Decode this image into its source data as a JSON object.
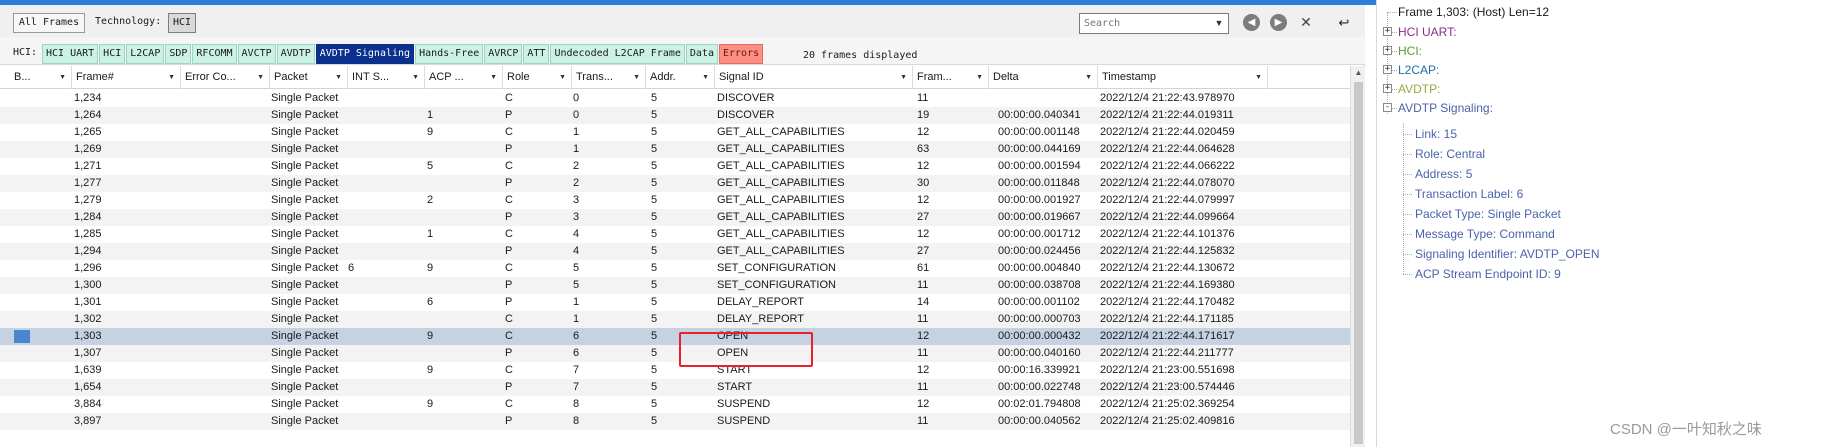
{
  "toolbar": {
    "all_frames": "All Frames",
    "technology_label": "Technology:",
    "technology_value": "HCI",
    "search_placeholder": "Search",
    "prev_icon": "arrow-left-circle-icon",
    "next_icon": "arrow-right-circle-icon",
    "close_icon": "close-icon",
    "export_icon": "export-icon"
  },
  "filterbar": {
    "label": "HCI:",
    "filters": [
      {
        "label": "HCI UART",
        "state": "normal"
      },
      {
        "label": "HCI",
        "state": "normal"
      },
      {
        "label": "L2CAP",
        "state": "normal"
      },
      {
        "label": "SDP",
        "state": "normal"
      },
      {
        "label": "RFCOMM",
        "state": "normal"
      },
      {
        "label": "AVCTP",
        "state": "normal"
      },
      {
        "label": "AVDTP",
        "state": "normal"
      },
      {
        "label": "AVDTP Signaling",
        "state": "active"
      },
      {
        "label": "Hands-Free",
        "state": "normal"
      },
      {
        "label": "AVRCP",
        "state": "normal"
      },
      {
        "label": "ATT",
        "state": "normal"
      },
      {
        "label": "Undecoded L2CAP Frame",
        "state": "normal"
      },
      {
        "label": "Data",
        "state": "normal"
      },
      {
        "label": "Errors",
        "state": "error"
      }
    ],
    "frames_displayed": "20 frames displayed"
  },
  "table": {
    "columns": [
      "B...",
      "Frame#",
      "Error Co...",
      "Packet",
      "INT S...",
      "ACP ...",
      "Role",
      "Trans...",
      "Addr.",
      "Signal ID",
      "Fram...",
      "Delta",
      "Timestamp"
    ],
    "rows": [
      {
        "frame": "1,234",
        "packet": "Single Packet",
        "int": "",
        "acp": "",
        "role": "C",
        "trans": "0",
        "addr": "5",
        "signal": "DISCOVER",
        "fram": "11",
        "delta": "",
        "ts": "2022/12/4 21:22:43.978970"
      },
      {
        "frame": "1,264",
        "packet": "Single Packet",
        "int": "",
        "acp": "1",
        "role": "P",
        "trans": "0",
        "addr": "5",
        "signal": "DISCOVER",
        "fram": "19",
        "delta": "00:00:00.040341",
        "ts": "2022/12/4 21:22:44.019311"
      },
      {
        "frame": "1,265",
        "packet": "Single Packet",
        "int": "",
        "acp": "9",
        "role": "C",
        "trans": "1",
        "addr": "5",
        "signal": "GET_ALL_CAPABILITIES",
        "fram": "12",
        "delta": "00:00:00.001148",
        "ts": "2022/12/4 21:22:44.020459"
      },
      {
        "frame": "1,269",
        "packet": "Single Packet",
        "int": "",
        "acp": "",
        "role": "P",
        "trans": "1",
        "addr": "5",
        "signal": "GET_ALL_CAPABILITIES",
        "fram": "63",
        "delta": "00:00:00.044169",
        "ts": "2022/12/4 21:22:44.064628"
      },
      {
        "frame": "1,271",
        "packet": "Single Packet",
        "int": "",
        "acp": "5",
        "role": "C",
        "trans": "2",
        "addr": "5",
        "signal": "GET_ALL_CAPABILITIES",
        "fram": "12",
        "delta": "00:00:00.001594",
        "ts": "2022/12/4 21:22:44.066222"
      },
      {
        "frame": "1,277",
        "packet": "Single Packet",
        "int": "",
        "acp": "",
        "role": "P",
        "trans": "2",
        "addr": "5",
        "signal": "GET_ALL_CAPABILITIES",
        "fram": "30",
        "delta": "00:00:00.011848",
        "ts": "2022/12/4 21:22:44.078070"
      },
      {
        "frame": "1,279",
        "packet": "Single Packet",
        "int": "",
        "acp": "2",
        "role": "C",
        "trans": "3",
        "addr": "5",
        "signal": "GET_ALL_CAPABILITIES",
        "fram": "12",
        "delta": "00:00:00.001927",
        "ts": "2022/12/4 21:22:44.079997"
      },
      {
        "frame": "1,284",
        "packet": "Single Packet",
        "int": "",
        "acp": "",
        "role": "P",
        "trans": "3",
        "addr": "5",
        "signal": "GET_ALL_CAPABILITIES",
        "fram": "27",
        "delta": "00:00:00.019667",
        "ts": "2022/12/4 21:22:44.099664"
      },
      {
        "frame": "1,285",
        "packet": "Single Packet",
        "int": "",
        "acp": "1",
        "role": "C",
        "trans": "4",
        "addr": "5",
        "signal": "GET_ALL_CAPABILITIES",
        "fram": "12",
        "delta": "00:00:00.001712",
        "ts": "2022/12/4 21:22:44.101376"
      },
      {
        "frame": "1,294",
        "packet": "Single Packet",
        "int": "",
        "acp": "",
        "role": "P",
        "trans": "4",
        "addr": "5",
        "signal": "GET_ALL_CAPABILITIES",
        "fram": "27",
        "delta": "00:00:00.024456",
        "ts": "2022/12/4 21:22:44.125832"
      },
      {
        "frame": "1,296",
        "packet": "Single Packet",
        "int": "6",
        "acp": "9",
        "role": "C",
        "trans": "5",
        "addr": "5",
        "signal": "SET_CONFIGURATION",
        "fram": "61",
        "delta": "00:00:00.004840",
        "ts": "2022/12/4 21:22:44.130672"
      },
      {
        "frame": "1,300",
        "packet": "Single Packet",
        "int": "",
        "acp": "",
        "role": "P",
        "trans": "5",
        "addr": "5",
        "signal": "SET_CONFIGURATION",
        "fram": "11",
        "delta": "00:00:00.038708",
        "ts": "2022/12/4 21:22:44.169380"
      },
      {
        "frame": "1,301",
        "packet": "Single Packet",
        "int": "",
        "acp": "6",
        "role": "P",
        "trans": "1",
        "addr": "5",
        "signal": "DELAY_REPORT",
        "fram": "14",
        "delta": "00:00:00.001102",
        "ts": "2022/12/4 21:22:44.170482"
      },
      {
        "frame": "1,302",
        "packet": "Single Packet",
        "int": "",
        "acp": "",
        "role": "C",
        "trans": "1",
        "addr": "5",
        "signal": "DELAY_REPORT",
        "fram": "11",
        "delta": "00:00:00.000703",
        "ts": "2022/12/4 21:22:44.171185"
      },
      {
        "frame": "1,303",
        "packet": "Single Packet",
        "int": "",
        "acp": "9",
        "role": "C",
        "trans": "6",
        "addr": "5",
        "signal": "OPEN",
        "fram": "12",
        "delta": "00:00:00.000432",
        "ts": "2022/12/4 21:22:44.171617"
      },
      {
        "frame": "1,307",
        "packet": "Single Packet",
        "int": "",
        "acp": "",
        "role": "P",
        "trans": "6",
        "addr": "5",
        "signal": "OPEN",
        "fram": "11",
        "delta": "00:00:00.040160",
        "ts": "2022/12/4 21:22:44.211777"
      },
      {
        "frame": "1,639",
        "packet": "Single Packet",
        "int": "",
        "acp": "9",
        "role": "C",
        "trans": "7",
        "addr": "5",
        "signal": "START",
        "fram": "12",
        "delta": "00:00:16.339921",
        "ts": "2022/12/4 21:23:00.551698"
      },
      {
        "frame": "1,654",
        "packet": "Single Packet",
        "int": "",
        "acp": "",
        "role": "P",
        "trans": "7",
        "addr": "5",
        "signal": "START",
        "fram": "11",
        "delta": "00:00:00.022748",
        "ts": "2022/12/4 21:23:00.574446"
      },
      {
        "frame": "3,884",
        "packet": "Single Packet",
        "int": "",
        "acp": "9",
        "role": "C",
        "trans": "8",
        "addr": "5",
        "signal": "SUSPEND",
        "fram": "12",
        "delta": "00:02:01.794808",
        "ts": "2022/12/4 21:25:02.369254"
      },
      {
        "frame": "3,897",
        "packet": "Single Packet",
        "int": "",
        "acp": "",
        "role": "P",
        "trans": "8",
        "addr": "5",
        "signal": "SUSPEND",
        "fram": "11",
        "delta": "00:00:00.040562",
        "ts": "2022/12/4 21:25:02.409816"
      }
    ],
    "selected_frame": "1,303"
  },
  "detail": {
    "frame_line": "Frame 1,303: (Host) Len=12",
    "nodes": [
      {
        "label": "HCI UART:",
        "color": "#8a2d8a",
        "expander": "+"
      },
      {
        "label": "HCI:",
        "color": "#5b9b28",
        "expander": "+"
      },
      {
        "label": "L2CAP:",
        "color": "#1f6fa8",
        "expander": "+"
      },
      {
        "label": "AVDTP:",
        "color": "#9aaa3a",
        "expander": "+"
      },
      {
        "label": "AVDTP Signaling:",
        "color": "#4b63a9",
        "expander": "-"
      }
    ],
    "children": [
      "Link: 15",
      "Role: Central",
      "Address: 5",
      "Transaction Label: 6",
      "Packet Type: Single Packet",
      "Message Type: Command",
      "Signaling Identifier: AVDTP_OPEN",
      "ACP Stream Endpoint ID: 9"
    ]
  },
  "watermark": "CSDN @一叶知秋之味"
}
